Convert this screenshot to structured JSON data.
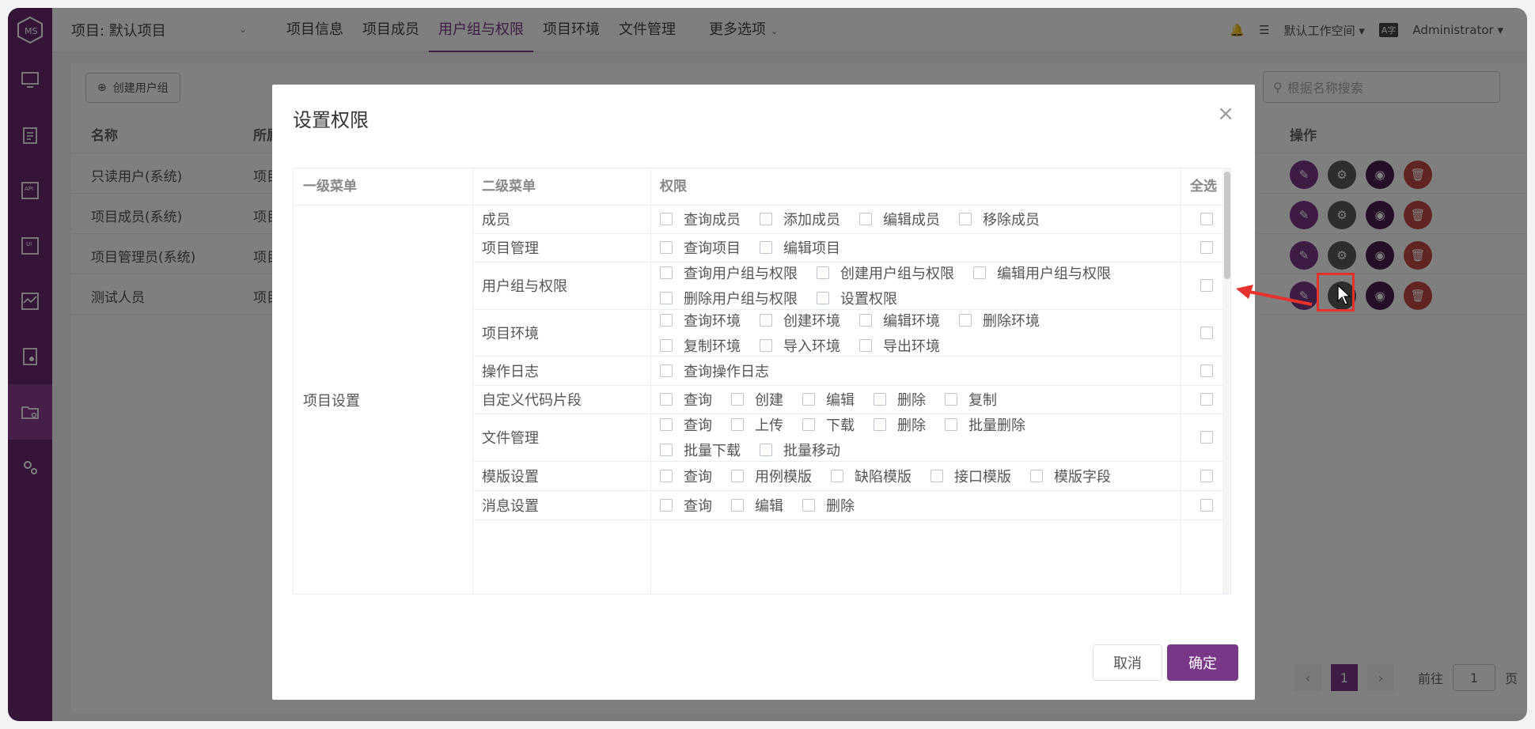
{
  "topbar": {
    "project_label": "项目: 默认项目",
    "menu": [
      "项目信息",
      "项目成员",
      "用户组与权限",
      "项目环境",
      "文件管理"
    ],
    "more_label": "更多选项",
    "workspace": "默认工作空间",
    "lang_badge": "A字",
    "user": "Administrator"
  },
  "sidenav": {
    "icons": [
      "monitor-icon",
      "clipboard-icon",
      "api-icon",
      "ui-icon",
      "performance-icon",
      "report-icon",
      "project-folder-icon",
      "settings-icon"
    ],
    "active_index": 6
  },
  "page": {
    "create_button": "创建用户组",
    "search_placeholder": "根据名称搜索",
    "table": {
      "headers": [
        "名称",
        "所属",
        "操作"
      ],
      "rows": [
        {
          "name": "只读用户(系统)",
          "scope": "项目"
        },
        {
          "name": "项目成员(系统)",
          "scope": "项目"
        },
        {
          "name": "项目管理员(系统)",
          "scope": "项目"
        },
        {
          "name": "测试人员",
          "scope": "项目"
        }
      ]
    },
    "pagination": {
      "current": "1",
      "goto_label": "前往",
      "goto_value": "1",
      "page_suffix": "页"
    }
  },
  "dialog": {
    "title": "设置权限",
    "close": "×",
    "headers": [
      "一级菜单",
      "二级菜单",
      "权限",
      "全选"
    ],
    "first_menu": "项目设置",
    "rows": [
      {
        "menu": "成员",
        "lines": [
          [
            "查询成员",
            "添加成员",
            "编辑成员",
            "移除成员"
          ]
        ]
      },
      {
        "menu": "项目管理",
        "lines": [
          [
            "查询项目",
            "编辑项目"
          ]
        ]
      },
      {
        "menu": "用户组与权限",
        "lines": [
          [
            "查询用户组与权限",
            "创建用户组与权限",
            "编辑用户组与权限"
          ],
          [
            "删除用户组与权限",
            "设置权限"
          ]
        ]
      },
      {
        "menu": "项目环境",
        "lines": [
          [
            "查询环境",
            "创建环境",
            "编辑环境",
            "删除环境"
          ],
          [
            "复制环境",
            "导入环境",
            "导出环境"
          ]
        ]
      },
      {
        "menu": "操作日志",
        "lines": [
          [
            "查询操作日志"
          ]
        ]
      },
      {
        "menu": "自定义代码片段",
        "lines": [
          [
            "查询",
            "创建",
            "编辑",
            "删除",
            "复制"
          ]
        ]
      },
      {
        "menu": "文件管理",
        "lines": [
          [
            "查询",
            "上传",
            "下载",
            "删除",
            "批量删除"
          ],
          [
            "批量下载",
            "批量移动"
          ]
        ]
      },
      {
        "menu": "模版设置",
        "lines": [
          [
            "查询",
            "用例模版",
            "缺陷模版",
            "接口模版",
            "模版字段"
          ]
        ]
      },
      {
        "menu": "消息设置",
        "lines": [
          [
            "查询",
            "编辑",
            "删除"
          ]
        ]
      }
    ],
    "cancel": "取消",
    "confirm": "确定"
  },
  "colors": {
    "brand": "#783887",
    "sidenav": "#6b2b6e",
    "annotation": "#e5322d"
  }
}
